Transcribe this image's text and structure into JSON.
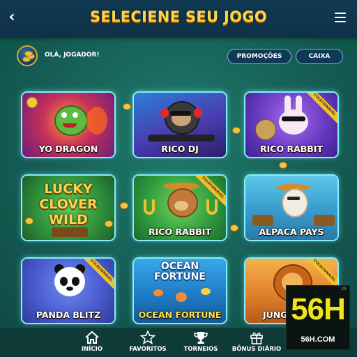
{
  "header": {
    "title": "SELECIENE SEU JOGO"
  },
  "user": {
    "greeting": "OLÁ, JOGADOR!"
  },
  "actions": {
    "promotions": "PROMOÇÕES",
    "cashier": "CAIXA"
  },
  "games": [
    {
      "name": "YO DRAGON",
      "collectible": false
    },
    {
      "name": "RICO DJ",
      "collectible": false
    },
    {
      "name": "RICO RABBIT",
      "collectible": true
    },
    {
      "name": "",
      "art_title": "LUCKY CLOVER WILD",
      "collectible": false
    },
    {
      "name": "RICO RABBIT",
      "collectible": true
    },
    {
      "name": "ALPACA PAYS",
      "collectible": false
    },
    {
      "name": "PANDA BLITZ",
      "collectible": true
    },
    {
      "name": "OCEAN FORTUNE",
      "art_title": "OCEAN FORTUNE",
      "collectible": false
    },
    {
      "name": "JUNGLE",
      "collectible": true
    }
  ],
  "ribbon_label": "COLECIONÁVEL",
  "art": {
    "lucky_line1": "LUCKY",
    "lucky_line2": "CLOVER",
    "lucky_line3": "WILD",
    "ocean_line1": "OCEAN",
    "ocean_line2": "FORTUNE"
  },
  "nav": [
    {
      "label": "INÍCIO",
      "icon": "home-icon"
    },
    {
      "label": "FAVORITOS",
      "icon": "star-icon"
    },
    {
      "label": "TORNEIOS",
      "icon": "trophy-icon"
    },
    {
      "label": "BÔNUS DIÁRIO",
      "icon": "gift-icon"
    }
  ],
  "watermark": {
    "big": "56H",
    "small": "56H.COM",
    "mini": "29"
  }
}
